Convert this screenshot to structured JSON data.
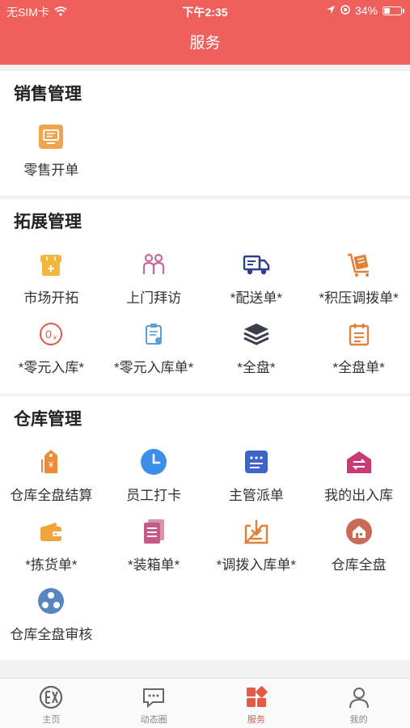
{
  "status_bar": {
    "carrier": "无SIM卡",
    "time": "下午2:35",
    "battery": "34%",
    "battery_level": 0.34
  },
  "header": {
    "title": "服务"
  },
  "sections": [
    {
      "title": "销售管理",
      "items": [
        {
          "label": "零售开单",
          "icon": "retail-order-icon"
        }
      ]
    },
    {
      "title": "拓展管理",
      "items": [
        {
          "label": "市场开拓",
          "icon": "market-expansion-icon"
        },
        {
          "label": "上门拜访",
          "icon": "visit-icon"
        },
        {
          "label": "*配送单*",
          "icon": "truck-icon"
        },
        {
          "label": "*积压调拨单*",
          "icon": "cart-icon"
        },
        {
          "label": "*零元入库*",
          "icon": "zero-yuan-icon"
        },
        {
          "label": "*零元入库单*",
          "icon": "clipboard-icon"
        },
        {
          "label": "*全盘*",
          "icon": "layers-icon"
        },
        {
          "label": "*全盘单*",
          "icon": "calendar-icon"
        }
      ]
    },
    {
      "title": "仓库管理",
      "items": [
        {
          "label": "仓库全盘结算",
          "icon": "price-tag-icon"
        },
        {
          "label": "员工打卡",
          "icon": "clock-icon"
        },
        {
          "label": "主管派单",
          "icon": "dispatch-icon"
        },
        {
          "label": "我的出入库",
          "icon": "warehouse-transfer-icon"
        },
        {
          "label": "*拣货单*",
          "icon": "wallet-icon"
        },
        {
          "label": "*装箱单*",
          "icon": "packing-list-icon"
        },
        {
          "label": "*调拨入库单*",
          "icon": "download-box-icon"
        },
        {
          "label": "仓库全盘",
          "icon": "house-icon"
        },
        {
          "label": "仓库全盘审核",
          "icon": "audit-icon"
        }
      ]
    }
  ],
  "tabbar": [
    {
      "label": "主页",
      "icon": "home-icon"
    },
    {
      "label": "动态圈",
      "icon": "chat-icon"
    },
    {
      "label": "服务",
      "icon": "services-icon",
      "active": true
    },
    {
      "label": "我的",
      "icon": "profile-icon"
    }
  ],
  "colors": {
    "header": "#ef5f5b",
    "active_tab": "#e35b45"
  }
}
